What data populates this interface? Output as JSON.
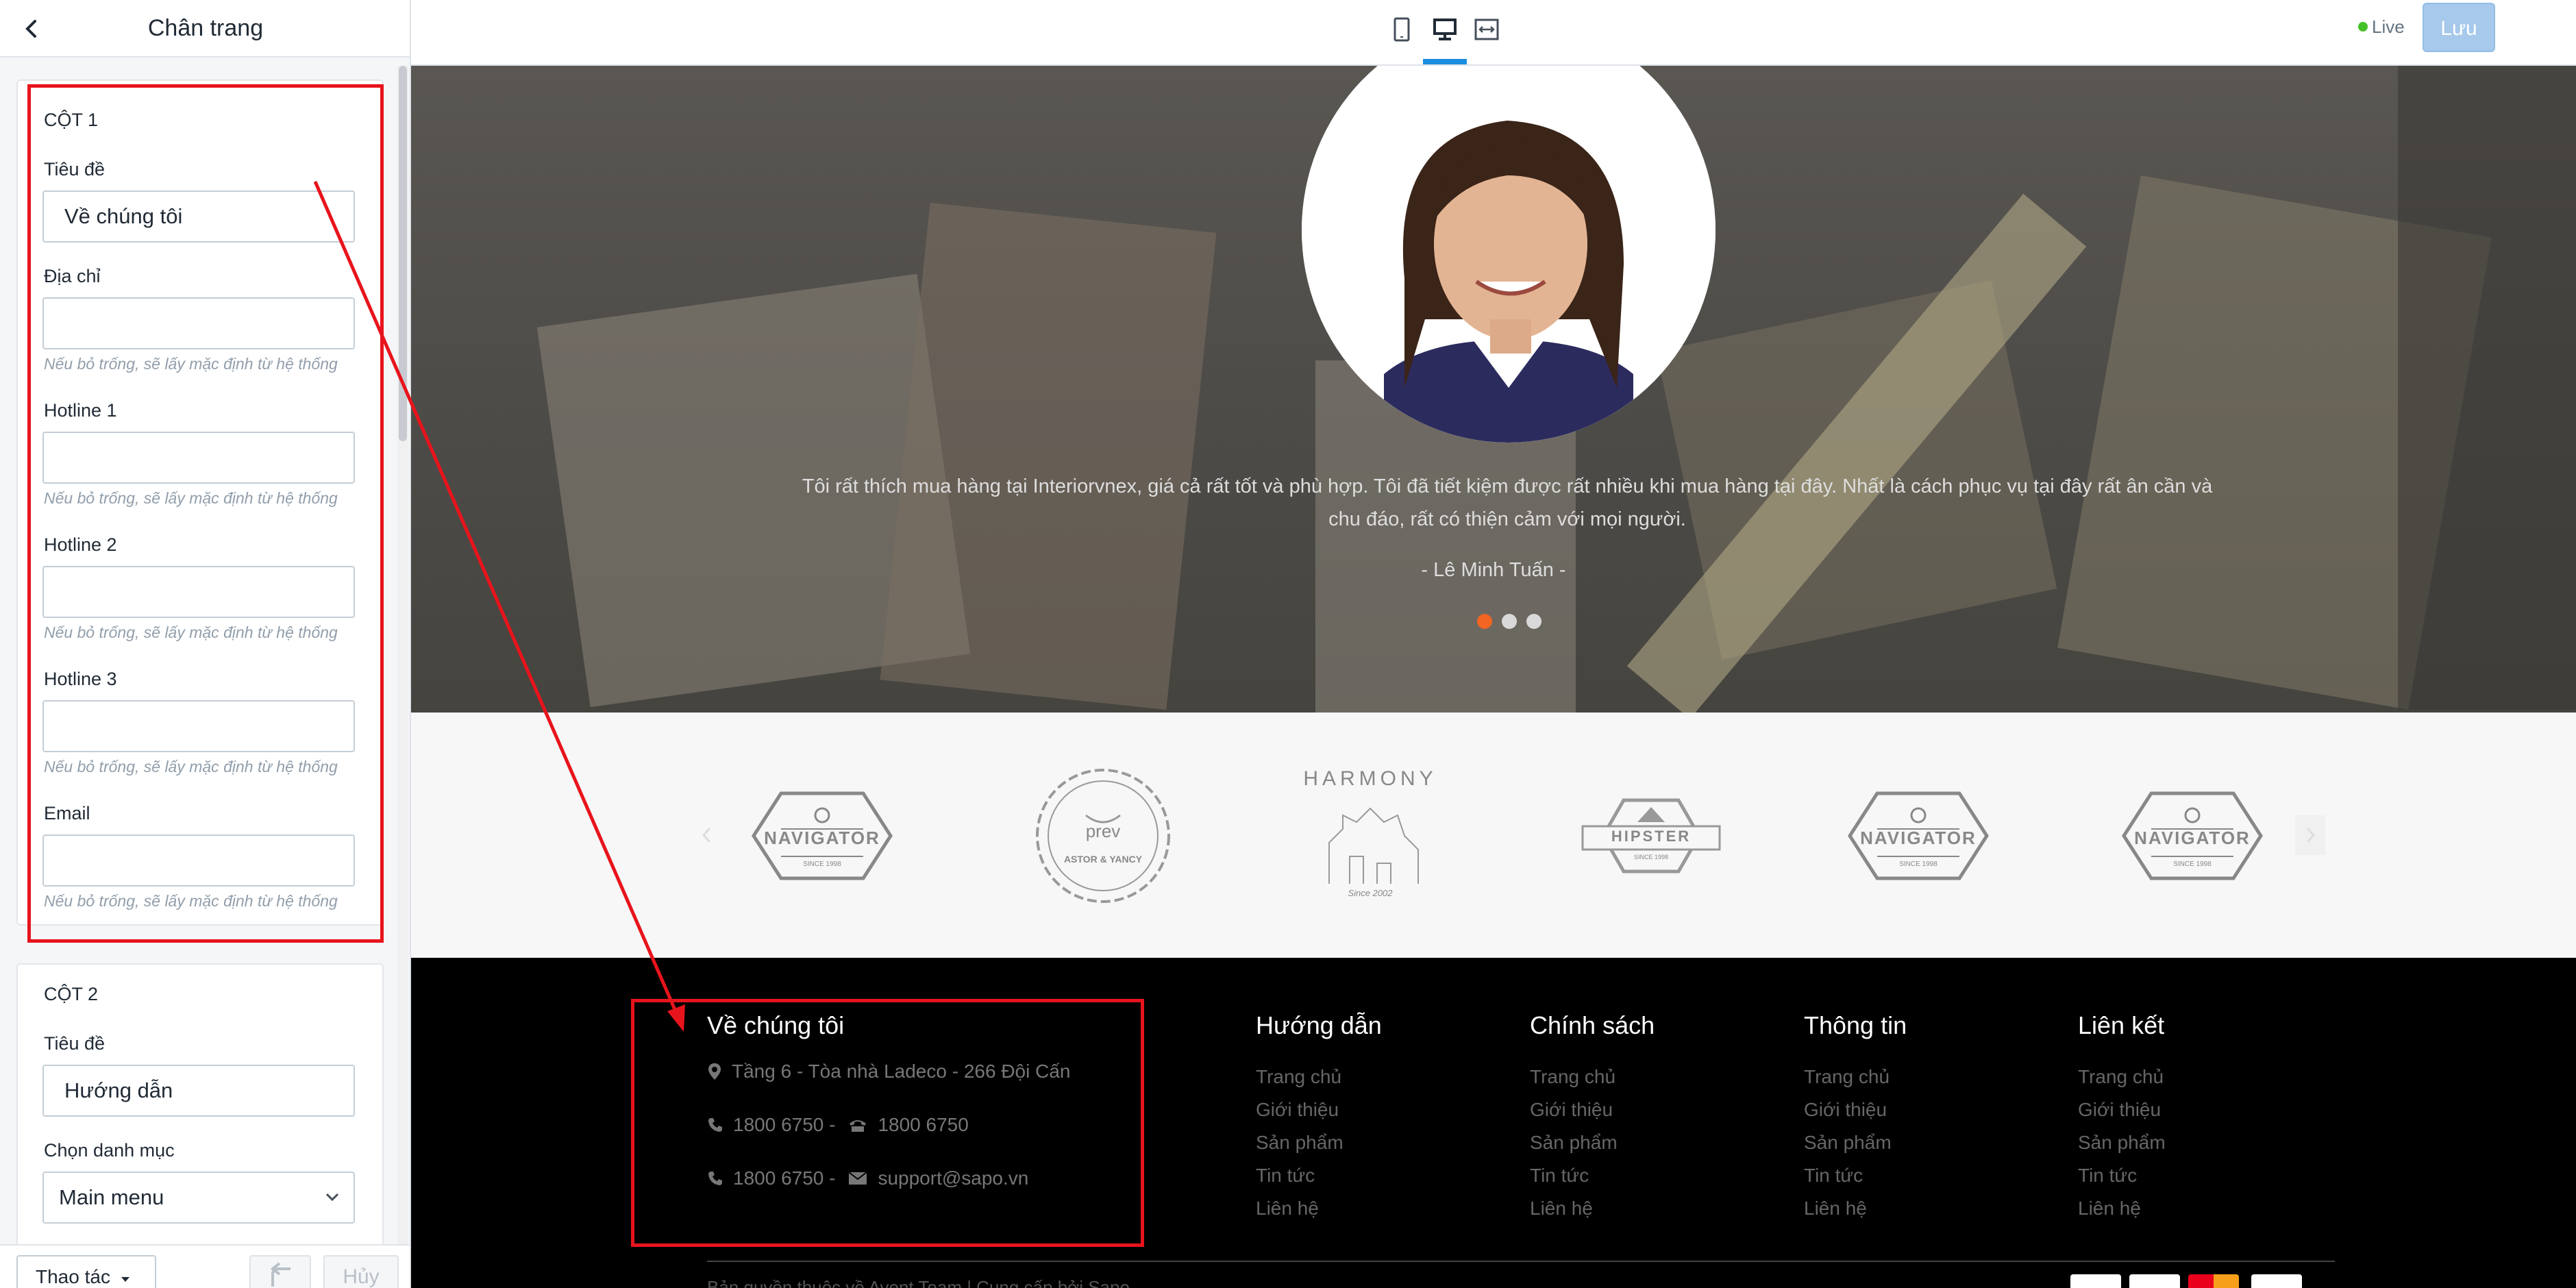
{
  "sidebar": {
    "title": "Chân trang",
    "column1": {
      "title": "CỘT 1",
      "fields": [
        {
          "label": "Tiêu đề",
          "value": "Về chúng tôi",
          "hint": ""
        },
        {
          "label": "Địa chỉ",
          "value": "",
          "hint": "Nếu bỏ trống, sẽ lấy mặc định từ hệ thống"
        },
        {
          "label": "Hotline 1",
          "value": "",
          "hint": "Nếu bỏ trống, sẽ lấy mặc định từ hệ thống"
        },
        {
          "label": "Hotline 2",
          "value": "",
          "hint": "Nếu bỏ trống, sẽ lấy mặc định từ hệ thống"
        },
        {
          "label": "Hotline 3",
          "value": "",
          "hint": "Nếu bỏ trống, sẽ lấy mặc định từ hệ thống"
        },
        {
          "label": "Email",
          "value": "",
          "hint": "Nếu bỏ trống, sẽ lấy mặc định từ hệ thống"
        }
      ]
    },
    "column2": {
      "title": "CỘT 2",
      "title_label": "Tiêu đề",
      "title_value": "Hướng dẫn",
      "category_label": "Chọn danh mục",
      "category_value": "Main menu"
    },
    "footer": {
      "actions_label": "Thao tác",
      "cancel_label": "Hủy"
    }
  },
  "topbar": {
    "live_label": "Live",
    "save_label": "Lưu"
  },
  "preview": {
    "testimonial": {
      "quote": "Tôi rất thích mua hàng tại Interiorvnex, giá cả rất tốt và phù hợp. Tôi đã tiết kiệm được rất nhiều khi mua hàng tại đây. Nhất là cách phục vụ tại đây rất ân cần và chu đáo, rất có thiện cảm với mọi người.",
      "author": "- Lê Minh Tuấn -",
      "active_slide": 1,
      "slide_count": 3
    },
    "brands": [
      {
        "name": "NAVIGATOR",
        "sub": "SINCE 1998"
      },
      {
        "name": "ASTOR & YANCY",
        "sub": "prev"
      },
      {
        "name": "HARMONY",
        "sub": "Since 2002"
      },
      {
        "name": "HIPSTER",
        "sub": "SINCE 1998"
      },
      {
        "name": "NAVIGATOR",
        "sub": "SINCE 1998"
      },
      {
        "name": "NAVIGATOR",
        "sub": "SINCE 1998"
      }
    ],
    "footer": {
      "about": {
        "title": "Về chúng tôi",
        "address": "Tầng 6 - Tòa nhà Ladeco - 266 Đội Cấn",
        "phone_a": "1800 6750 -",
        "phone_b": "1800 6750",
        "phone_c": "1800 6750 -",
        "email": "support@sapo.vn"
      },
      "columns": [
        {
          "title": "Hướng dẫn",
          "links": [
            "Trang chủ",
            "Giới thiệu",
            "Sản phẩm",
            "Tin tức",
            "Liên hệ"
          ]
        },
        {
          "title": "Chính sách",
          "links": [
            "Trang chủ",
            "Giới thiệu",
            "Sản phẩm",
            "Tin tức",
            "Liên hệ"
          ]
        },
        {
          "title": "Thông tin",
          "links": [
            "Trang chủ",
            "Giới thiệu",
            "Sản phẩm",
            "Tin tức",
            "Liên hệ"
          ]
        },
        {
          "title": "Liên kết",
          "links": [
            "Trang chủ",
            "Giới thiệu",
            "Sản phẩm",
            "Tin tức",
            "Liên hệ"
          ]
        }
      ],
      "copyright": "Bản quyền thuộc về Avent Team | Cung cấp bởi Sapo"
    }
  },
  "colors": {
    "annotation_red": "#e8141c",
    "accent_blue": "#1a8fe0",
    "save_button": "#a6c9ec",
    "slider_active_dot": "#f26522",
    "live_dot": "#47c12a"
  },
  "icons": [
    "chevron-left-icon",
    "mobile-icon",
    "desktop-icon",
    "fullwidth-icon",
    "map-pin-icon",
    "phone-icon",
    "fax-icon",
    "mail-icon",
    "undo-icon",
    "caret-down-icon"
  ]
}
